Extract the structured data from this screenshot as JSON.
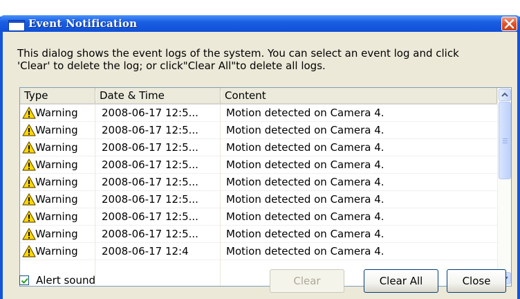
{
  "window": {
    "title": "Event Notification",
    "description_lines": [
      "This dialog shows the event logs of the system. You can select an event log and click",
      "'Clear' to delete the log; or click\"Clear All\"to delete all logs."
    ]
  },
  "table": {
    "columns": [
      "Type",
      "Date & Time",
      "Content"
    ],
    "rows": [
      {
        "type": "Warning",
        "datetime": "2008-06-17 12:5...",
        "content": "Motion detected on Camera 4."
      },
      {
        "type": "Warning",
        "datetime": "2008-06-17 12:5...",
        "content": "Motion detected on Camera 4."
      },
      {
        "type": "Warning",
        "datetime": "2008-06-17 12:5...",
        "content": "Motion detected on Camera 4."
      },
      {
        "type": "Warning",
        "datetime": "2008-06-17 12:5...",
        "content": "Motion detected on Camera 4."
      },
      {
        "type": "Warning",
        "datetime": "2008-06-17 12:5...",
        "content": "Motion detected on Camera 4."
      },
      {
        "type": "Warning",
        "datetime": "2008-06-17 12:5...",
        "content": "Motion detected on Camera 4."
      },
      {
        "type": "Warning",
        "datetime": "2008-06-17 12:5...",
        "content": "Motion detected on Camera 4."
      },
      {
        "type": "Warning",
        "datetime": "2008-06-17 12:5...",
        "content": "Motion detected on Camera 4."
      },
      {
        "type": "Warning",
        "datetime": "2008-06-17 12:4",
        "content": "Motion detected on Camera 4."
      }
    ],
    "type_icon": "warning-triangle-icon"
  },
  "footer": {
    "alert_sound_label": "Alert sound",
    "alert_sound_checked": true,
    "clear_label": "Clear",
    "clear_enabled": false,
    "clear_all_label": "Clear All",
    "close_label": "Close"
  },
  "colors": {
    "titlebar": "#0f4fd6",
    "close_button": "#e0522a",
    "dialog_bg": "#ece9d8",
    "warning_fill": "#ffd800"
  }
}
